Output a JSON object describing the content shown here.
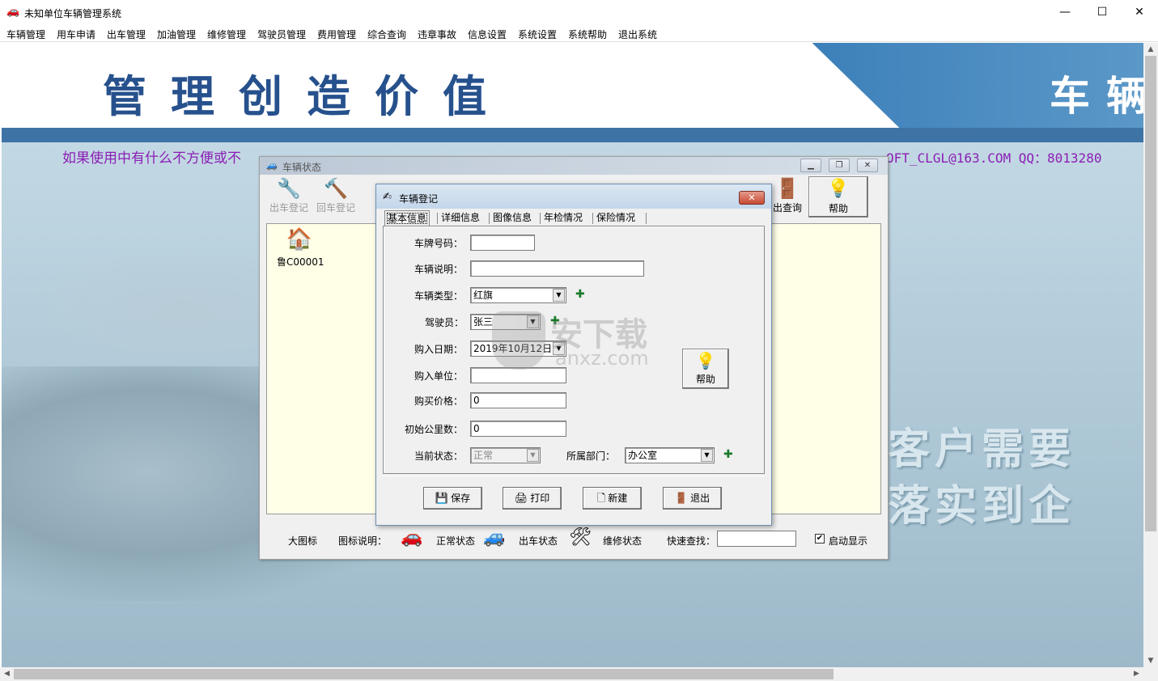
{
  "window": {
    "title": "未知单位车辆管理系统",
    "controls": {
      "minimize": "—",
      "maximize": "☐",
      "close": "✕"
    }
  },
  "menu": [
    "车辆管理",
    "用车申请",
    "出车管理",
    "加油管理",
    "维修管理",
    "驾驶员管理",
    "费用管理",
    "综合查询",
    "违章事故",
    "信息设置",
    "系统设置",
    "系统帮助",
    "退出系统"
  ],
  "banner": {
    "slogan": "管理创造价值",
    "slogan_right": "车辆",
    "marquee_left": "如果使用中有什么不方便或不",
    "marquee_right": "OFT_CLGL@163.COM QQ：8013280",
    "slogan2": "客户需要",
    "slogan3": "落实到企"
  },
  "status_window": {
    "title": "车辆状态",
    "toolbar": [
      {
        "label": "出车登记",
        "icon": "car-out-icon"
      },
      {
        "label": "回车登记",
        "icon": "car-return-icon"
      },
      {
        "label": "出查询",
        "icon": "query-icon"
      },
      {
        "label": "帮助",
        "icon": "lightbulb-icon"
      }
    ],
    "vehicles": [
      {
        "plate": "鲁C00001",
        "icon": "house-car-icon"
      }
    ],
    "footer": {
      "large_icon": "大图标",
      "legend_label": "图标说明：",
      "normal": "正常状态",
      "out": "出车状态",
      "repair": "维修状态",
      "quick_search": "快速查找：",
      "auto_show": "启动显示",
      "auto_show_checked": "✔"
    }
  },
  "dialog": {
    "title": "车辆登记",
    "tabs": [
      "基本信息",
      "详细信息",
      "图像信息",
      "年检情况",
      "保险情况"
    ],
    "fields": {
      "plate_label": "车牌号码：",
      "plate_value": "",
      "desc_label": "车辆说明：",
      "desc_value": "",
      "type_label": "车辆类型：",
      "type_value": "红旗",
      "driver_label": "驾驶员：",
      "driver_value": "张三",
      "date_label": "购入日期：",
      "date_value": "2019年10月12日",
      "unit_label": "购入单位：",
      "unit_value": "",
      "price_label": "购买价格：",
      "price_value": "0",
      "mileage_label": "初始公里数：",
      "mileage_value": "0",
      "status_label": "当前状态：",
      "status_value": "正常",
      "dept_label": "所属部门：",
      "dept_value": "办公室"
    },
    "help": "帮助",
    "buttons": {
      "save": "保存",
      "print": "打印",
      "new": "新建",
      "exit": "退出"
    }
  },
  "watermark": {
    "text": "安下载",
    "sub": "anxz.com"
  }
}
